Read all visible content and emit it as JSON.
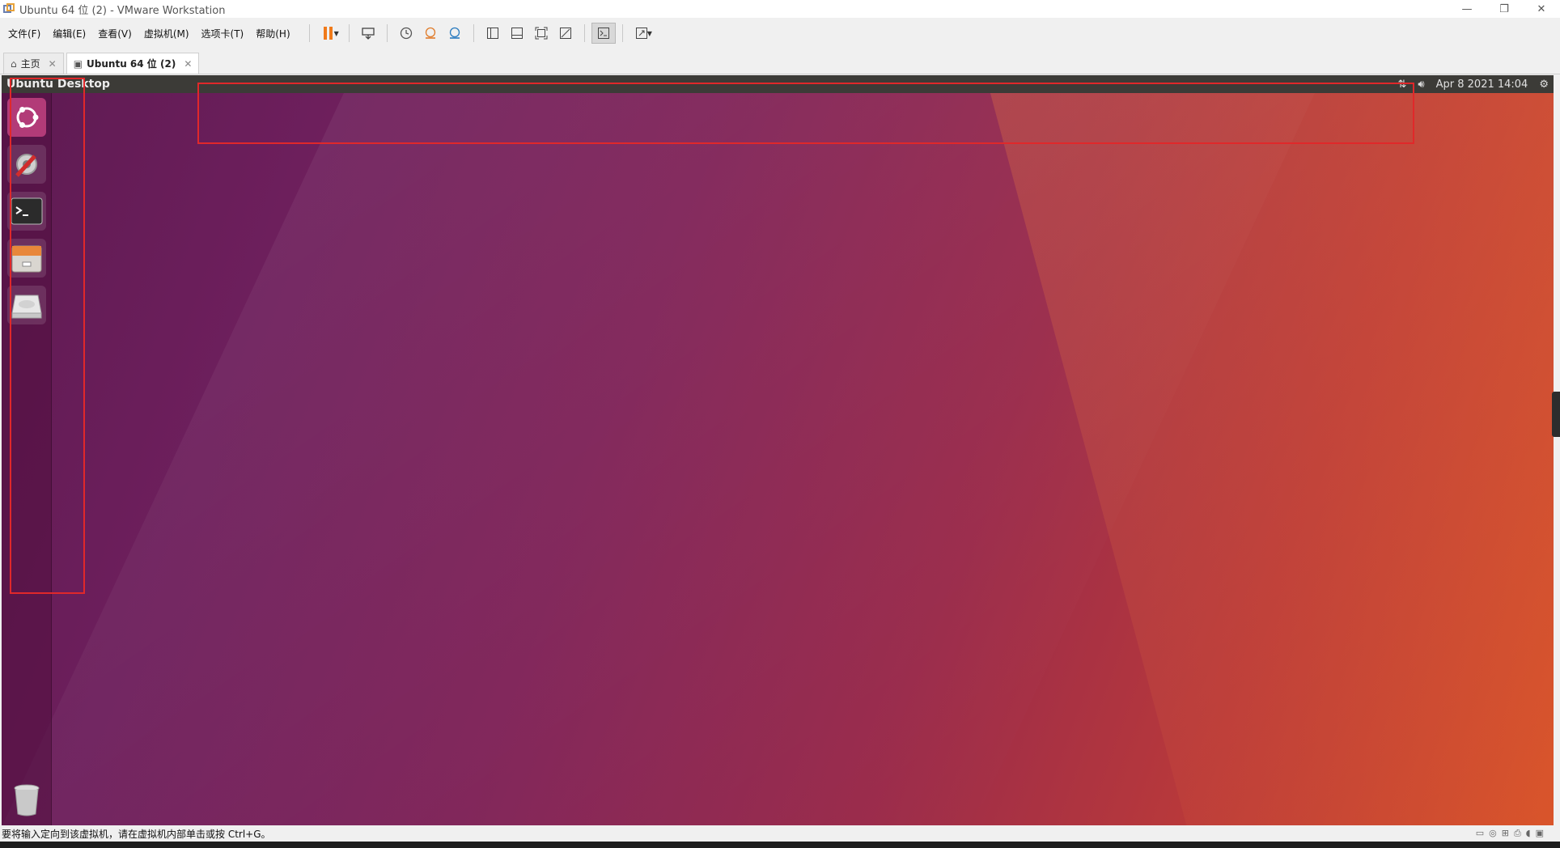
{
  "window": {
    "title": "Ubuntu 64 位 (2) - VMware Workstation",
    "controls": {
      "minimize": "—",
      "restore": "❐",
      "close": "✕"
    }
  },
  "menu": {
    "items": [
      "文件(F)",
      "编辑(E)",
      "查看(V)",
      "虚拟机(M)",
      "选项卡(T)",
      "帮助(H)"
    ]
  },
  "tabs": [
    {
      "label": "主页",
      "icon": "home-icon",
      "close": "✕"
    },
    {
      "label": "Ubuntu 64 位 (2)",
      "icon": "vm-icon",
      "close": "✕",
      "active": true
    }
  ],
  "ubuntu": {
    "topbar_title": "Ubuntu Desktop",
    "clock": "Apr  8 2021 14:04",
    "indicators": [
      "network-icon",
      "volume-icon",
      "settings-gear-icon"
    ],
    "launcher": [
      "ubuntu-dash-icon",
      "system-settings-icon",
      "terminal-icon",
      "file-manager-icon",
      "disk-icon",
      "trash-icon"
    ]
  },
  "status": {
    "message": "要将输入定向到该虚拟机，请在虚拟机内部单击或按 Ctrl+G。"
  },
  "colors": {
    "highlight": "#e0282a",
    "pause": "#f07a1a",
    "ubuntu_topbar": "#3c3b37"
  }
}
